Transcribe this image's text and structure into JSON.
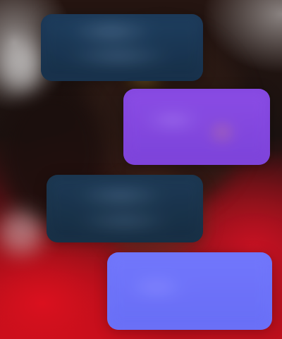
{
  "thread": {
    "messages": [
      {
        "direction": "incoming",
        "text": ""
      },
      {
        "direction": "outgoing",
        "text": ""
      },
      {
        "direction": "incoming",
        "text": ""
      },
      {
        "direction": "outgoing",
        "text": ""
      }
    ]
  },
  "colors": {
    "incoming_bubble": "#1c3550",
    "outgoing_bubble_1": "#7f46d6",
    "outgoing_bubble_2": "#6f74f2",
    "background_red": "#c41424",
    "background_dark": "#1b1210"
  }
}
